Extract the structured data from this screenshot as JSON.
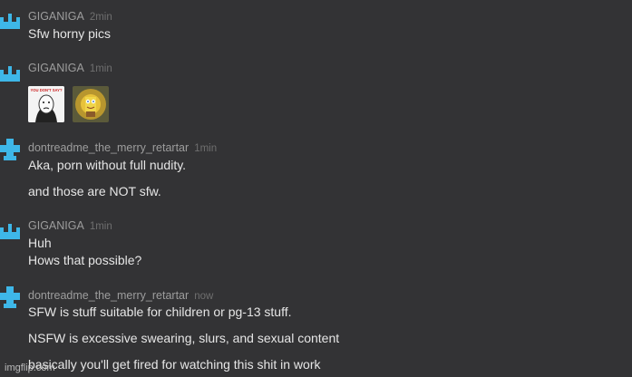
{
  "colors": {
    "background": "#333335",
    "avatar_accent": "#3eb7e8",
    "username": "#9d9d9d",
    "timestamp": "#6f6f6f",
    "text": "#e6e6e6"
  },
  "messages": [
    {
      "user": "GIGANIGA",
      "time": "2min",
      "avatar_icon": "crown-avatar-icon",
      "lines": [
        "Sfw horny pics"
      ]
    },
    {
      "user": "GIGANIGA",
      "time": "1min",
      "avatar_icon": "crown-avatar-icon",
      "lines": [],
      "images": [
        "you-dont-say-meme-thumbnail",
        "spongebob-meme-thumbnail"
      ],
      "image_caption": "YOU DON'T SAY?"
    },
    {
      "user": "dontreadme_the_merry_retartar",
      "time": "1min",
      "avatar_icon": "cross-avatar-icon",
      "lines": [
        "Aka, porn without full nudity.",
        "and those are NOT sfw."
      ]
    },
    {
      "user": "GIGANIGA",
      "time": "1min",
      "avatar_icon": "crown-avatar-icon",
      "lines": [
        "Huh",
        "Hows that possible?"
      ]
    },
    {
      "user": "dontreadme_the_merry_retartar",
      "time": "now",
      "avatar_icon": "cross-avatar-icon",
      "lines": [
        "SFW is stuff suitable for children or pg-13 stuff.",
        "NSFW is excessive swearing, slurs, and sexual content",
        "basically you'll get fired for watching this shit in work"
      ]
    }
  ],
  "watermark": "imgflip.com"
}
